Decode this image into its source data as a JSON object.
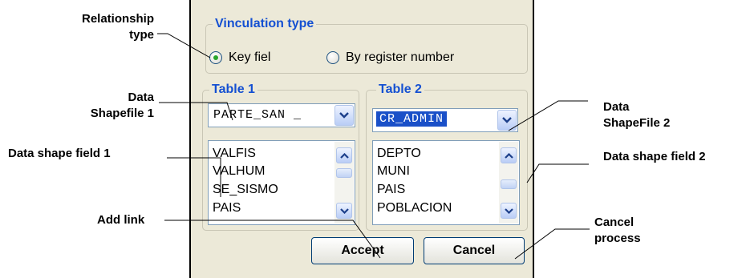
{
  "callouts": {
    "relationship_type": [
      "Relationship",
      "type"
    ],
    "data_shapefile_1": [
      "Data",
      "Shapefile  1"
    ],
    "data_shape_field_1": "Data shape field 1",
    "add_link": "Add link",
    "data_shapefile_2": [
      "Data",
      "ShapeFile  2"
    ],
    "data_shape_field_2": "Data shape field 2",
    "cancel_process": [
      "Cancel",
      "process"
    ]
  },
  "vinculation": {
    "legend": "Vinculation type",
    "options": [
      {
        "label": "Key fiel",
        "checked": true
      },
      {
        "label": "By register number",
        "checked": false
      }
    ]
  },
  "table1": {
    "legend": "Table 1",
    "combo_value": "PARTE_SAN _",
    "fields": [
      "VALFIS",
      "VALHUM",
      "SE_SISMO",
      "PAIS"
    ]
  },
  "table2": {
    "legend": "Table 2",
    "combo_value": "CR_ADMIN",
    "fields": [
      "DEPTO",
      "MUNI",
      "PAIS",
      "POBLACION"
    ]
  },
  "buttons": {
    "accept": "Accept",
    "cancel": "Cancel"
  },
  "icons": {
    "combo_arrow": "chevron-down-icon",
    "scroll_up": "chevron-up-icon",
    "scroll_down": "chevron-down-icon"
  },
  "colors": {
    "accent": "#1450d2",
    "selected": "#1a50c8",
    "radio_dot": "#2aa52a",
    "panel_bg": "#ece9d8"
  }
}
